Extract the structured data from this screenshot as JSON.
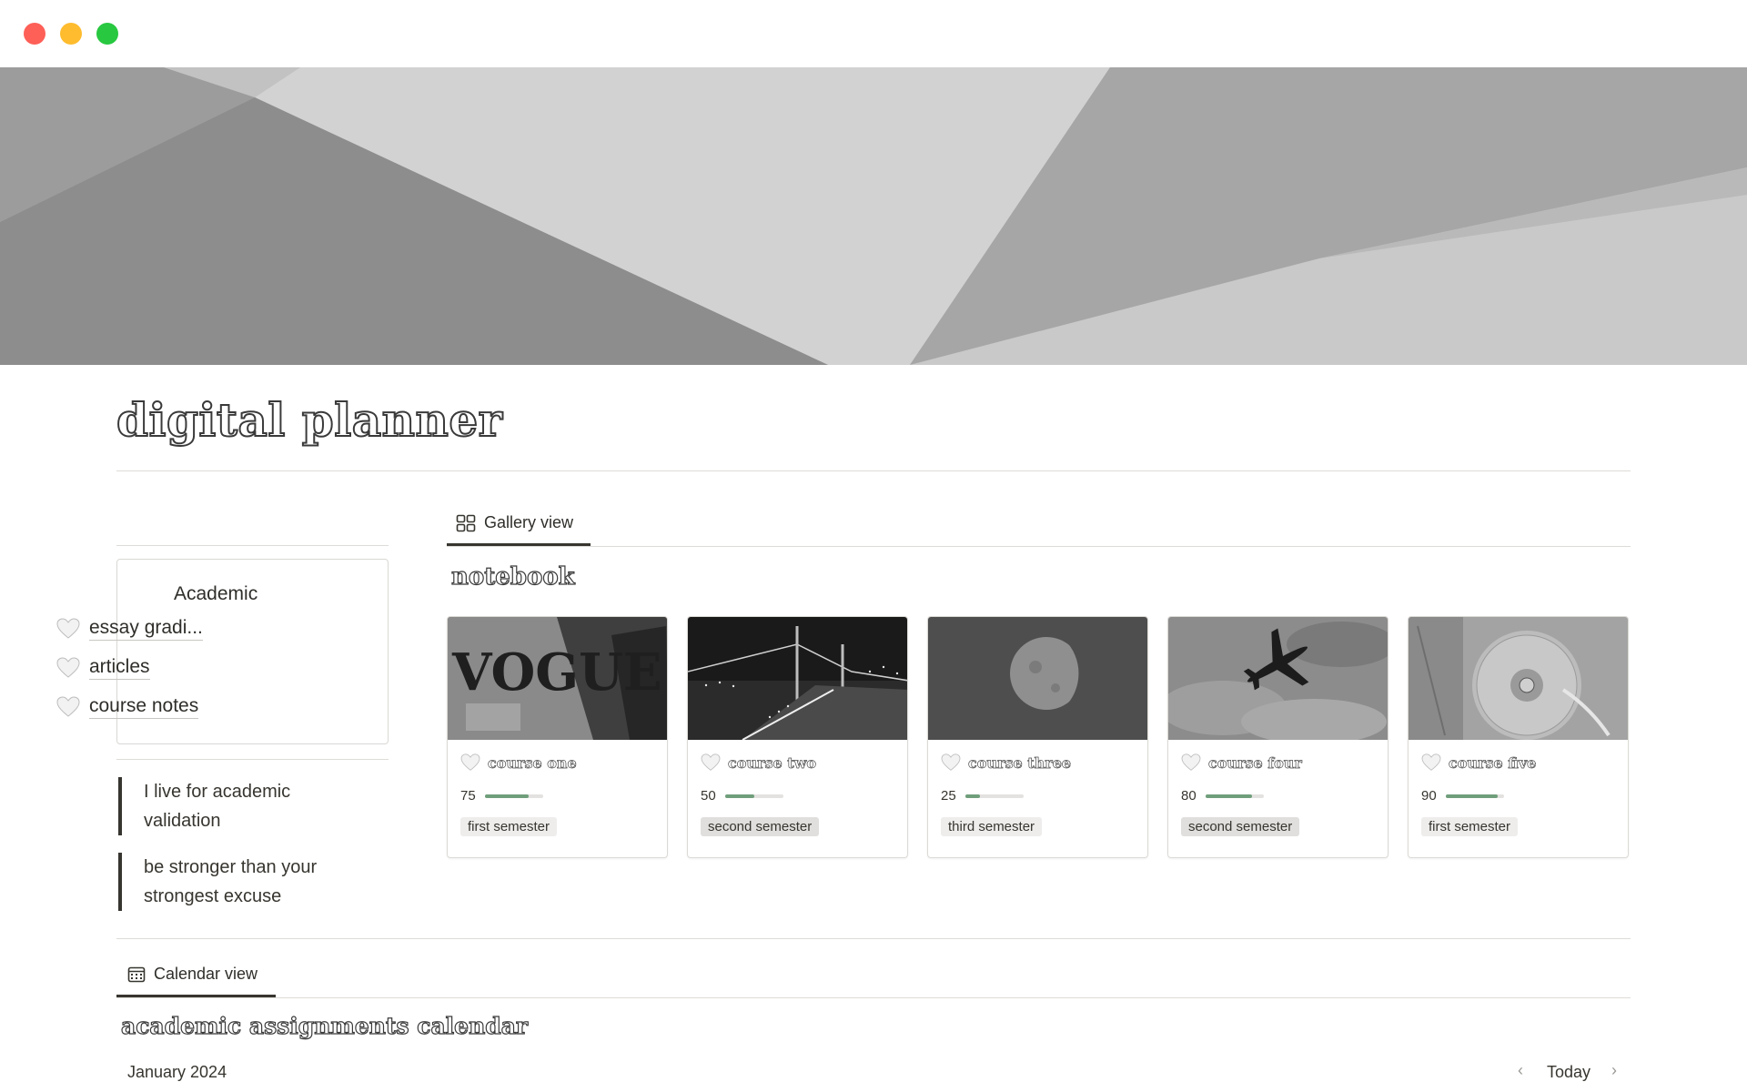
{
  "window": {
    "controls": [
      "close",
      "minimize",
      "zoom"
    ]
  },
  "page": {
    "title": "digital planner"
  },
  "sidebar": {
    "heading": "Academic",
    "links": [
      {
        "label": "essay gradi...",
        "icon": "white-heart-icon"
      },
      {
        "label": "articles",
        "icon": "white-heart-icon"
      },
      {
        "label": "course notes",
        "icon": "white-heart-icon"
      }
    ],
    "quotes": [
      "I live for academic validation",
      "be stronger than your strongest excuse"
    ]
  },
  "gallery": {
    "tab_label": "Gallery view",
    "title": "notebook",
    "cards": [
      {
        "name": "course one",
        "progress": 75,
        "tag": "first semester",
        "image": "magazine-photo"
      },
      {
        "name": "course two",
        "progress": 50,
        "tag": "second semester",
        "image": "bridge-night-photo"
      },
      {
        "name": "course three",
        "progress": 25,
        "tag": "third semester",
        "image": "moon-photo"
      },
      {
        "name": "course four",
        "progress": 80,
        "tag": "second semester",
        "image": "airplane-sky-photo"
      },
      {
        "name": "course five",
        "progress": 90,
        "tag": "first semester",
        "image": "cd-photo"
      }
    ]
  },
  "calendar": {
    "tab_label": "Calendar view",
    "title": "academic assignments calendar",
    "month": "January 2024",
    "today_label": "Today"
  },
  "colors": {
    "progress_fill": "#6f9e7b",
    "text": "#37352f"
  }
}
